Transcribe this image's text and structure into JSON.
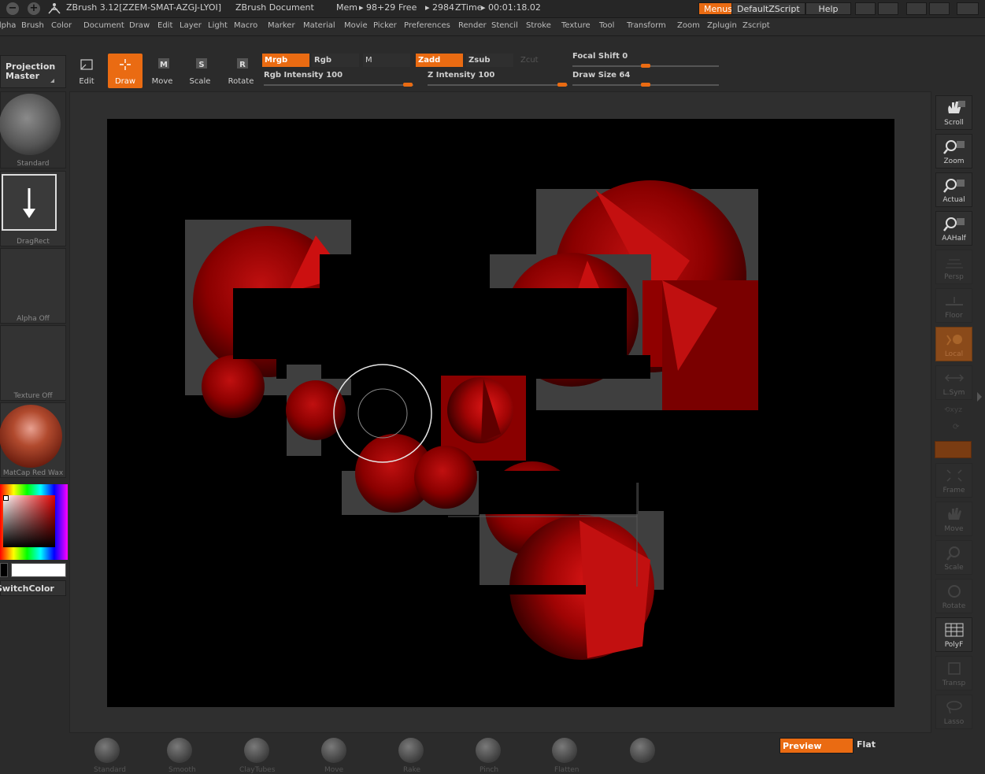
{
  "titlebar": {
    "app_title": "ZBrush 3.12[ZZEM-SMAT-AZGJ-LYOI]",
    "document": "ZBrush Document",
    "mem_label": "Mem",
    "mem_value": "98+29",
    "free_label": "Free",
    "free_value": "2984",
    "ztime_label": "ZTime",
    "ztime_value": "00:01:18.02",
    "menus_btn": "Menus",
    "script_btn": "DefaultZScript",
    "help_btn": "Help",
    "minimize_glyph": "−",
    "maximize_glyph": "+"
  },
  "menubar": {
    "items": [
      "Alpha",
      "Brush",
      "Color",
      "Document",
      "Draw",
      "Edit",
      "Layer",
      "Light",
      "Macro",
      "Marker",
      "Material",
      "Movie",
      "Picker",
      "Preferences",
      "Render",
      "Stencil",
      "Stroke",
      "Texture",
      "Tool",
      "Transform",
      "Zoom",
      "Zplugin",
      "Zscript"
    ]
  },
  "toolbar": {
    "projection_master": "Projection Master",
    "edit": "Edit",
    "draw": "Draw",
    "move": "Move",
    "scale": "Scale",
    "rotate": "Rotate",
    "mrgb": "Mrgb",
    "rgb": "Rgb",
    "m": "M",
    "zadd": "Zadd",
    "zsub": "Zsub",
    "zcut": "Zcut",
    "rgb_intensity_label": "Rgb Intensity",
    "rgb_intensity_value": "100",
    "z_intensity_label": "Z Intensity",
    "z_intensity_value": "100",
    "focal_shift_label": "Focal Shift",
    "focal_shift_value": "0",
    "draw_size_label": "Draw Size",
    "draw_size_value": "64"
  },
  "lefttray": {
    "brush_label": "Standard",
    "stroke_label": "DragRect",
    "alpha_label": "Alpha Off",
    "texture_label": "Texture Off",
    "material_label": "MatCap Red Wax",
    "switch_color": "SwitchColor"
  },
  "rightshelf": {
    "buttons": [
      "Scroll",
      "Zoom",
      "Actual",
      "AAHalf",
      "Persp",
      "Floor",
      "Local",
      "L.Sym",
      "Frame",
      "Move",
      "Scale",
      "Rotate",
      "PolyF",
      "Transp",
      "Lasso"
    ]
  },
  "bottomshelf": {
    "brushes": [
      "Standard",
      "Smooth",
      "ClayTubes",
      "Move",
      "Rake",
      "Pinch",
      "Flatten",
      ""
    ],
    "preview": "Preview",
    "flat": "Flat"
  },
  "colors": {
    "accent": "#ea6b12",
    "background": "#2b2b2b",
    "canvas": "#000000"
  }
}
